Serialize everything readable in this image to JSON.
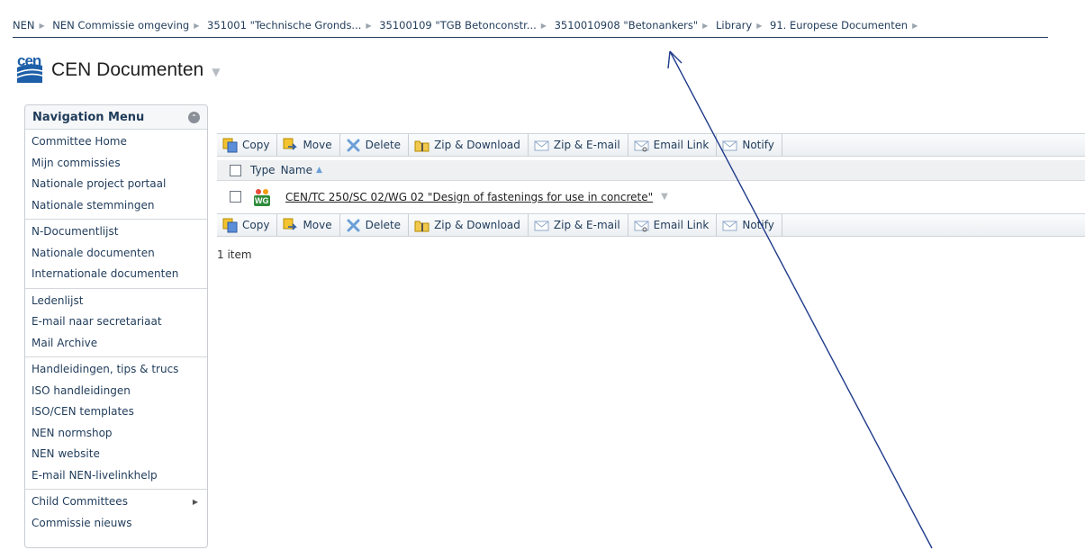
{
  "breadcrumb": [
    "NEN",
    "NEN Commissie omgeving",
    "351001 \"Technische Gronds...",
    "35100109 \"TGB Betonconstr...",
    "3510010908 \"Betonankers\"",
    "Library",
    "91. Europese Documenten"
  ],
  "header": {
    "logo_text": "cen",
    "title": "CEN Documenten"
  },
  "nav": {
    "title": "Navigation Menu",
    "groups": [
      [
        "Committee Home",
        "Mijn commissies",
        "Nationale project portaal",
        "Nationale stemmingen"
      ],
      [
        "N-Documentlijst",
        "Nationale documenten",
        "Internationale documenten"
      ],
      [
        "Ledenlijst",
        "E-mail naar secretariaat",
        "Mail Archive"
      ],
      [
        "Handleidingen, tips & trucs",
        "ISO handleidingen",
        "ISO/CEN templates",
        "NEN normshop",
        "NEN website",
        "E-mail NEN-livelinkhelp"
      ],
      [
        "Child Committees",
        "Commissie nieuws"
      ]
    ]
  },
  "toolbar": {
    "copy": "Copy",
    "move": "Move",
    "delete": "Delete",
    "zip_download": "Zip & Download",
    "zip_email": "Zip & E-mail",
    "email_link": "Email Link",
    "notify": "Notify"
  },
  "table": {
    "col_type": "Type",
    "col_name": "Name",
    "rows": [
      {
        "type_icon": "WG",
        "name": "CEN/TC 250/SC 02/WG 02 \"Design of fastenings for use in concrete\""
      }
    ]
  },
  "item_count": "1 item",
  "colors": {
    "link": "#1f3b5a",
    "accent": "#1d5fa8",
    "annotation": "#1f3b8a"
  }
}
